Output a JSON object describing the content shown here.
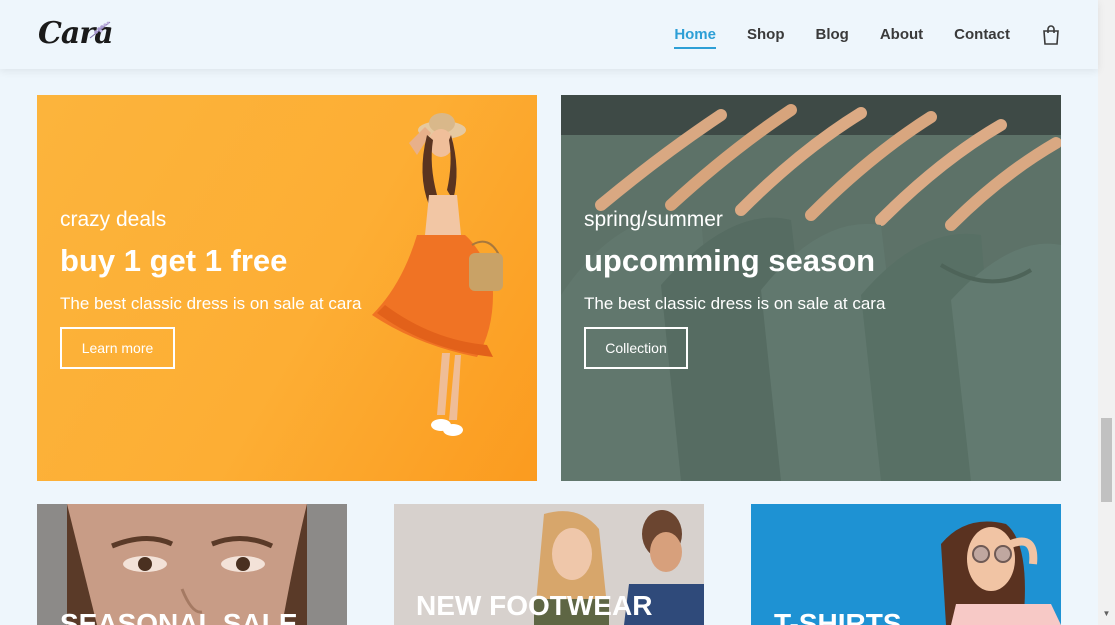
{
  "header": {
    "logo": "Cara",
    "nav": [
      {
        "label": "Home",
        "active": true
      },
      {
        "label": "Shop",
        "active": false
      },
      {
        "label": "Blog",
        "active": false
      },
      {
        "label": "About",
        "active": false
      },
      {
        "label": "Contact",
        "active": false
      }
    ],
    "cart_icon": "shopping-bag-icon"
  },
  "banners": [
    {
      "subtitle": "crazy deals",
      "title": "buy 1 get 1 free",
      "description": "The best classic dress is on sale at cara",
      "button": "Learn more"
    },
    {
      "subtitle": "spring/summer",
      "title": "upcomming season",
      "description": "The best classic dress is on sale at cara",
      "button": "Collection"
    }
  ],
  "cards": [
    {
      "label": "SEASONAL SALE"
    },
    {
      "label": "NEW FOOTWEAR"
    },
    {
      "label": "T-SHIRTS"
    }
  ],
  "colors": {
    "accent": "#2d9fd6",
    "background": "#eef6fc",
    "banner_left": "#fdae34",
    "banner_right": "#55695f"
  }
}
